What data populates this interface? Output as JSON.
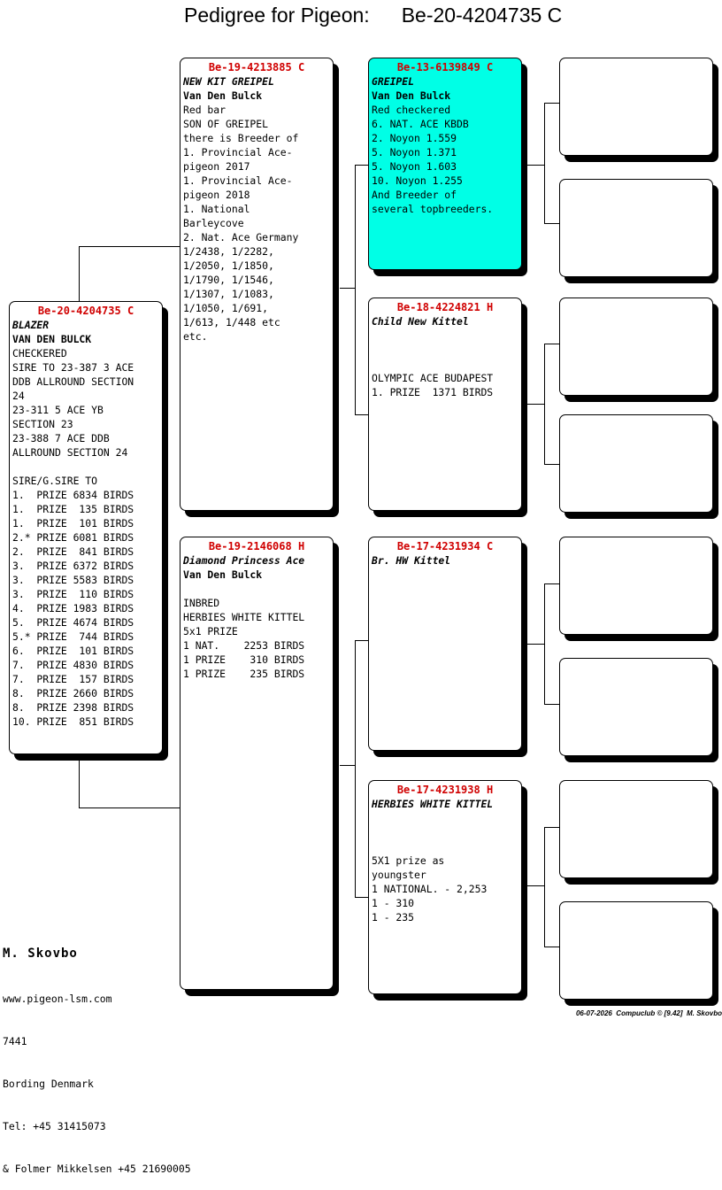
{
  "title": {
    "label": "Pedigree for Pigeon:",
    "ring": "Be-20-4204735 C"
  },
  "subject": {
    "ring": "Be-20-4204735 C",
    "name": "BLAZER",
    "owner": "VAN DEN BULCK",
    "lines": [
      "CHECKERED",
      "SIRE TO 23-387 3 ACE",
      "DDB ALLROUND SECTION",
      "24",
      "23-311 5 ACE YB",
      "SECTION 23",
      "23-388 7 ACE DDB",
      "ALLROUND SECTION 24",
      "",
      "SIRE/G.SIRE TO",
      "1.  PRIZE 6834 BIRDS",
      "1.  PRIZE  135 BIRDS",
      "1.  PRIZE  101 BIRDS",
      "2.* PRIZE 6081 BIRDS",
      "2.  PRIZE  841 BIRDS",
      "3.  PRIZE 6372 BIRDS",
      "3.  PRIZE 5583 BIRDS",
      "3.  PRIZE  110 BIRDS",
      "4.  PRIZE 1983 BIRDS",
      "5.  PRIZE 4674 BIRDS",
      "5.* PRIZE  744 BIRDS",
      "6.  PRIZE  101 BIRDS",
      "7.  PRIZE 4830 BIRDS",
      "7.  PRIZE  157 BIRDS",
      "8.  PRIZE 2660 BIRDS",
      "8.  PRIZE 2398 BIRDS",
      "10. PRIZE  851 BIRDS"
    ]
  },
  "sire": {
    "ring": "Be-19-4213885 C",
    "name": "NEW KIT GREIPEL",
    "owner": "Van Den Bulck",
    "lines": [
      "Red bar",
      "SON OF GREIPEL",
      "there is Breeder of",
      "1. Provincial Ace-",
      "pigeon 2017",
      "1. Provincial Ace-",
      "pigeon 2018",
      "1. National",
      "Barleycove",
      "2. Nat. Ace Germany",
      "1/2438, 1/2282,",
      "1/2050, 1/1850,",
      "1/1790, 1/1546,",
      "1/1307, 1/1083,",
      "1/1050, 1/691,",
      "1/613, 1/448 etc",
      "etc."
    ]
  },
  "dam": {
    "ring": "Be-19-2146068 H",
    "name": "Diamond Princess Ace",
    "owner": "Van Den Bulck",
    "lines": [
      "",
      "INBRED",
      "HERBIES WHITE KITTEL",
      "5x1 PRIZE",
      "1 NAT.    2253 BIRDS",
      "1 PRIZE    310 BIRDS",
      "1 PRIZE    235 BIRDS"
    ]
  },
  "sire_sire": {
    "ring": "Be-13-6139849 C",
    "name": "GREIPEL",
    "owner": "Van Den Bulck",
    "lines": [
      "Red checkered",
      "6. NAT. ACE KBDB",
      "2. Noyon 1.559",
      "5. Noyon 1.371",
      "5. Noyon 1.603",
      "10. Noyon 1.255",
      "And Breeder of",
      "several topbreeders."
    ]
  },
  "sire_dam": {
    "ring": "Be-18-4224821 H",
    "name": "Child New Kittel",
    "owner": "",
    "lines": [
      "",
      "",
      "OLYMPIC ACE BUDAPEST",
      "1. PRIZE  1371 BIRDS"
    ]
  },
  "dam_sire": {
    "ring": "Be-17-4231934 C",
    "name": "Br. HW Kittel",
    "owner": "",
    "lines": []
  },
  "dam_dam": {
    "ring": "Be-17-4231938 H",
    "name": "HERBIES WHITE KITTEL",
    "owner": "",
    "lines": [
      "",
      "",
      "5X1 prize as",
      "youngster",
      "1 NATIONAL. - 2,253",
      "1 - 310",
      "1 - 235"
    ]
  },
  "breeder": {
    "name": "M. Skovbo",
    "lines": [
      "www.pigeon-lsm.com",
      "7441",
      "Bording Denmark",
      "Tel: +45 31415073",
      "& Folmer Mikkelsen +45 21690005"
    ]
  },
  "footer": "06-07-2026  Compuclub © [9.42]  M. Skovbo",
  "colors": {
    "ring": "#d00000",
    "highlight": "#00ffe6"
  }
}
